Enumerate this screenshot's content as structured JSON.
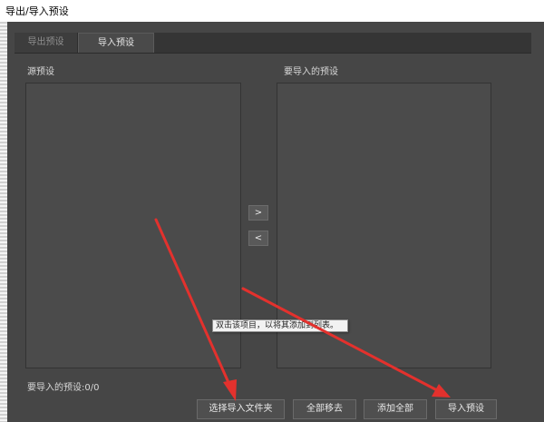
{
  "window": {
    "title": "导出/导入预设"
  },
  "tabs": [
    {
      "label": "导出预设",
      "active": false
    },
    {
      "label": "导入预设",
      "active": true
    }
  ],
  "source_panel": {
    "label": "源预设"
  },
  "target_panel": {
    "label": "要导入的预设"
  },
  "transfer": {
    "add_label": ">",
    "remove_label": "<"
  },
  "tooltip": {
    "text": "双击该项目，以将其添加到列表。"
  },
  "status": {
    "count_text": "要导入的预设:0/0"
  },
  "buttons": {
    "choose_folder": "选择导入文件夹",
    "remove_all": "全部移去",
    "add_all": "添加全部",
    "import": "导入预设"
  },
  "colors": {
    "background": "#464646",
    "annotation_arrow": "#e3312d"
  }
}
